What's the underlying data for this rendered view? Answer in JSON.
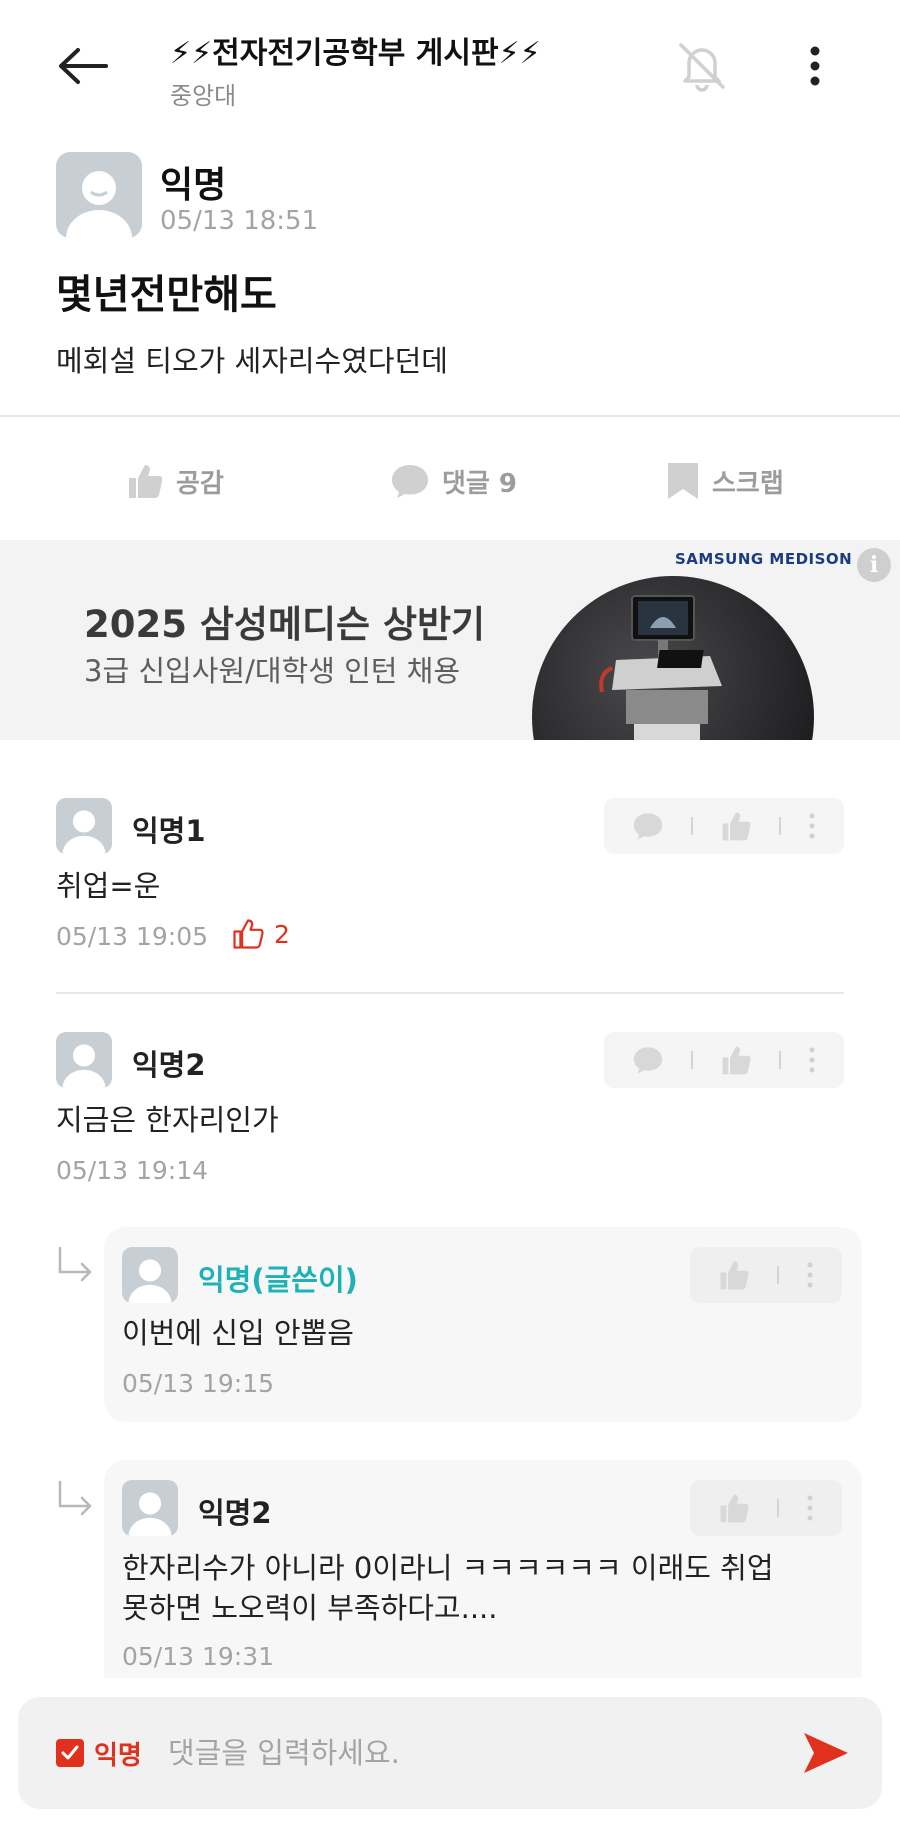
{
  "header": {
    "title": "⚡⚡전자전기공학부 게시판⚡⚡",
    "subtitle": "중앙대"
  },
  "post": {
    "author": "익명",
    "time": "05/13 18:51",
    "title": "몇년전만해도",
    "body": "메회설 티오가 세자리수였다던데"
  },
  "actions": {
    "like_label": "공감",
    "comment_label": "댓글 9",
    "scrap_label": "스크랩"
  },
  "ad": {
    "brand": "SAMSUNG MEDISON",
    "title": "2025 삼성메디슨 상반기",
    "subtitle": "3급 신입사원/대학생 인턴 채용",
    "info_icon": "i"
  },
  "comments": [
    {
      "author": "익명1",
      "text": "취업=운",
      "time": "05/13 19:05",
      "likes": "2"
    },
    {
      "author": "익명2",
      "text": "지금은 한자리인가",
      "time": "05/13 19:14"
    }
  ],
  "replies": [
    {
      "author": "익명(글쓴이)",
      "text": "이번에 신입 안뽑음",
      "time": "05/13 19:15"
    },
    {
      "author": "익명2",
      "text_line1": "한자리수가 아니라 0이라니 ㅋㅋㅋㅋㅋㅋ 이래도 취업",
      "text_line2": "못하면 노오력이 부족하다고....",
      "time": "05/13 19:31"
    }
  ],
  "input": {
    "anon_label": "익명",
    "placeholder": "댓글을 입력하세요."
  },
  "colors": {
    "accent_red": "#e0301e",
    "op_teal": "#1fb1b8",
    "muted": "#a4a4a4"
  }
}
